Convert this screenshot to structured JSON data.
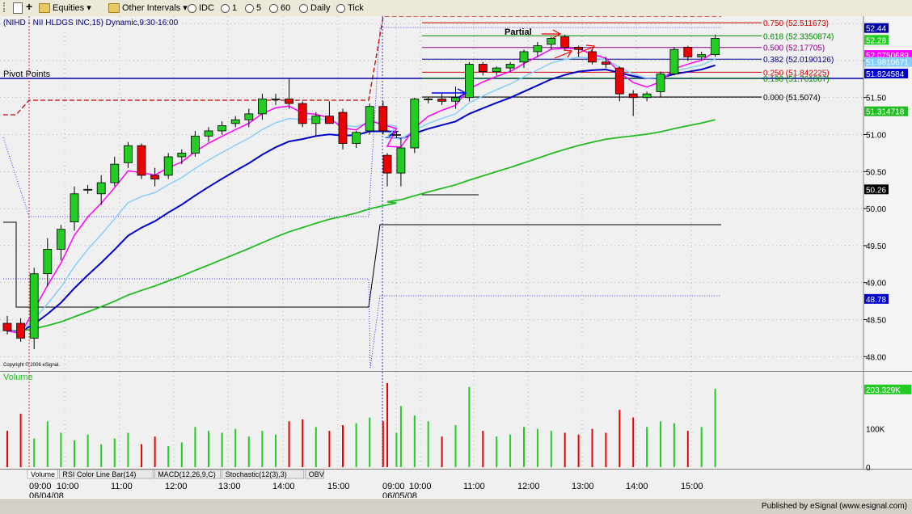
{
  "toolbar": {
    "equities_label": "Equities",
    "other_intervals_label": "Other Intervals",
    "intervals": [
      {
        "label": "IDC",
        "selected": false
      },
      {
        "label": "1",
        "selected": false
      },
      {
        "label": "5",
        "selected": false
      },
      {
        "label": "60",
        "selected": false
      },
      {
        "label": "Daily",
        "selected": false
      },
      {
        "label": "Tick",
        "selected": false
      }
    ]
  },
  "chart_title": "(NIHD - NII HLDGS INC,15) Dynamic,9:30-16:00",
  "pivot_label": "Pivot Points",
  "partial_label": "Partial",
  "copyright": "Copyright © 2006 eSignal.",
  "volume_label": "Volume",
  "published": "Published by eSignal (www.esignal.com)",
  "colors": {
    "up": "#22cc22",
    "down": "#ee0000",
    "ema_fast": "#ff00ff",
    "ema_light": "#87cefa",
    "ma_blue": "#0000cc",
    "ma_green": "#22bb22",
    "pivot": "#0000aa",
    "stop": "#cc0000"
  },
  "price_axis": {
    "ticks": [
      "52.00",
      "51.50",
      "51.00",
      "50.50",
      "50.00",
      "49.50",
      "49.00",
      "48.50",
      "48.00"
    ],
    "badges": [
      {
        "text": "52.44",
        "color": "#0000aa"
      },
      {
        "text": "52.28",
        "color": "#22cc22"
      },
      {
        "text": "52.0750689",
        "color": "#ff00ff"
      },
      {
        "text": "51.9810671",
        "color": "#87cefa"
      },
      {
        "text": "51.824584",
        "color": "#0000cc"
      },
      {
        "text": "51.314718",
        "color": "#22bb22"
      },
      {
        "text": "50.26",
        "color": "#000000"
      },
      {
        "text": "48.78",
        "color": "#0000cc"
      }
    ]
  },
  "volume_axis": {
    "ticks": [
      "203.329K",
      "100K",
      "0"
    ]
  },
  "time_axis": {
    "times": [
      "09:00",
      "10:00",
      "11:00",
      "12:00",
      "13:00",
      "14:00",
      "15:00",
      "09:00",
      "10:00",
      "11:00",
      "12:00",
      "13:00",
      "14:00",
      "15:00"
    ],
    "dates": [
      "06/04/08",
      "06/05/08"
    ]
  },
  "fib_levels": [
    {
      "text": "0.750 (52.511673)",
      "color": "#cc0000"
    },
    {
      "text": "0.618 (52.3350874)",
      "color": "#008800"
    },
    {
      "text": "0.500 (52.17705)",
      "color": "#880088"
    },
    {
      "text": "0.382 (52.0190126)",
      "color": "#000088"
    },
    {
      "text": "0.250 (51.842225)",
      "color": "#cc0000"
    },
    {
      "text": "0.190 (51.761867)",
      "color": "#008800"
    },
    {
      "text": "0.000 (51.5074)",
      "color": "#000000"
    }
  ],
  "tabs": [
    "Volume",
    "RSI Color Line Bar(14)",
    "MACD(12,26,9,C)",
    "Stochastic(12(3),3)",
    "OBV"
  ],
  "chart_data": {
    "type": "candlestick",
    "symbol": "NIHD",
    "interval": "15",
    "ylim": [
      47.85,
      52.6
    ],
    "volume_ylim": [
      0,
      220
    ],
    "bars": [
      {
        "o": 48.45,
        "h": 48.55,
        "l": 48.3,
        "c": 48.35,
        "v": 95
      },
      {
        "o": 48.45,
        "h": 48.52,
        "l": 48.2,
        "c": 48.25,
        "v": 140
      },
      {
        "o": 48.25,
        "h": 49.2,
        "l": 48.1,
        "c": 49.12,
        "v": 75
      },
      {
        "o": 49.12,
        "h": 49.6,
        "l": 48.95,
        "c": 49.45,
        "v": 120
      },
      {
        "o": 49.45,
        "h": 49.78,
        "l": 49.3,
        "c": 49.72,
        "v": 90
      },
      {
        "o": 49.82,
        "h": 50.3,
        "l": 49.7,
        "c": 50.2,
        "v": 70
      },
      {
        "o": 50.25,
        "h": 50.32,
        "l": 50.2,
        "c": 50.26,
        "v": 85
      },
      {
        "o": 50.2,
        "h": 50.45,
        "l": 50.05,
        "c": 50.35,
        "v": 60
      },
      {
        "o": 50.35,
        "h": 50.7,
        "l": 50.3,
        "c": 50.6,
        "v": 75
      },
      {
        "o": 50.62,
        "h": 50.9,
        "l": 50.55,
        "c": 50.85,
        "v": 90
      },
      {
        "o": 50.85,
        "h": 50.88,
        "l": 50.4,
        "c": 50.45,
        "v": 60
      },
      {
        "o": 50.45,
        "h": 50.55,
        "l": 50.3,
        "c": 50.4,
        "v": 80
      },
      {
        "o": 50.45,
        "h": 50.75,
        "l": 50.4,
        "c": 50.7,
        "v": 55
      },
      {
        "o": 50.7,
        "h": 50.8,
        "l": 50.6,
        "c": 50.75,
        "v": 65
      },
      {
        "o": 50.75,
        "h": 51.05,
        "l": 50.7,
        "c": 50.98,
        "v": 105
      },
      {
        "o": 50.98,
        "h": 51.1,
        "l": 50.9,
        "c": 51.05,
        "v": 95
      },
      {
        "o": 51.05,
        "h": 51.18,
        "l": 51.0,
        "c": 51.12,
        "v": 90
      },
      {
        "o": 51.15,
        "h": 51.25,
        "l": 51.1,
        "c": 51.2,
        "v": 100
      },
      {
        "o": 51.2,
        "h": 51.35,
        "l": 51.1,
        "c": 51.28,
        "v": 80
      },
      {
        "o": 51.28,
        "h": 51.55,
        "l": 51.2,
        "c": 51.48,
        "v": 95
      },
      {
        "o": 51.48,
        "h": 51.55,
        "l": 51.4,
        "c": 51.48,
        "v": 85
      },
      {
        "o": 51.48,
        "h": 51.75,
        "l": 51.35,
        "c": 51.42,
        "v": 120
      },
      {
        "o": 51.42,
        "h": 51.45,
        "l": 51.1,
        "c": 51.15,
        "v": 125
      },
      {
        "o": 51.15,
        "h": 51.3,
        "l": 50.98,
        "c": 51.25,
        "v": 105
      },
      {
        "o": 51.25,
        "h": 51.45,
        "l": 51.15,
        "c": 51.15,
        "v": 95
      },
      {
        "o": 51.3,
        "h": 51.35,
        "l": 50.8,
        "c": 50.88,
        "v": 110
      },
      {
        "o": 50.88,
        "h": 51.05,
        "l": 50.82,
        "c": 51.03,
        "v": 115
      },
      {
        "o": 51.05,
        "h": 51.42,
        "l": 51.0,
        "c": 51.38,
        "v": 130
      },
      {
        "o": 51.38,
        "h": 51.45,
        "l": 51.0,
        "c": 51.05,
        "v": 120
      },
      {
        "o": 51.0,
        "h": 51.05,
        "l": 50.95,
        "c": 51.0,
        "v": 90
      },
      {
        "o": 50.72,
        "h": 50.75,
        "l": 50.3,
        "c": 50.48,
        "v": 220
      },
      {
        "o": 50.48,
        "h": 50.95,
        "l": 50.3,
        "c": 50.82,
        "v": 160
      },
      {
        "o": 50.82,
        "h": 51.5,
        "l": 50.75,
        "c": 51.48,
        "v": 135
      },
      {
        "o": 51.48,
        "h": 51.5,
        "l": 51.42,
        "c": 51.48,
        "v": 120
      },
      {
        "o": 51.48,
        "h": 51.55,
        "l": 51.4,
        "c": 51.45,
        "v": 80
      },
      {
        "o": 51.45,
        "h": 51.65,
        "l": 51.35,
        "c": 51.5,
        "v": 110
      },
      {
        "o": 51.5,
        "h": 51.98,
        "l": 51.45,
        "c": 51.95,
        "v": 210
      },
      {
        "o": 51.95,
        "h": 51.98,
        "l": 51.8,
        "c": 51.85,
        "v": 95
      },
      {
        "o": 51.85,
        "h": 51.92,
        "l": 51.8,
        "c": 51.9,
        "v": 80
      },
      {
        "o": 51.9,
        "h": 51.98,
        "l": 51.85,
        "c": 51.95,
        "v": 85
      },
      {
        "o": 51.98,
        "h": 52.15,
        "l": 51.9,
        "c": 52.12,
        "v": 105
      },
      {
        "o": 52.12,
        "h": 52.25,
        "l": 52.05,
        "c": 52.2,
        "v": 100
      },
      {
        "o": 52.22,
        "h": 52.32,
        "l": 52.15,
        "c": 52.3,
        "v": 95
      },
      {
        "o": 52.32,
        "h": 52.35,
        "l": 52.15,
        "c": 52.18,
        "v": 90
      },
      {
        "o": 52.18,
        "h": 52.2,
        "l": 52.05,
        "c": 52.15,
        "v": 85
      },
      {
        "o": 52.12,
        "h": 52.15,
        "l": 51.95,
        "c": 51.98,
        "v": 100
      },
      {
        "o": 51.98,
        "h": 52.05,
        "l": 51.9,
        "c": 51.95,
        "v": 90
      },
      {
        "o": 51.9,
        "h": 51.92,
        "l": 51.45,
        "c": 51.55,
        "v": 150
      },
      {
        "o": 51.55,
        "h": 51.6,
        "l": 51.25,
        "c": 51.5,
        "v": 130
      },
      {
        "o": 51.5,
        "h": 51.58,
        "l": 51.45,
        "c": 51.55,
        "v": 105
      },
      {
        "o": 51.58,
        "h": 51.85,
        "l": 51.5,
        "c": 51.82,
        "v": 120
      },
      {
        "o": 51.82,
        "h": 52.18,
        "l": 51.8,
        "c": 52.15,
        "v": 115
      },
      {
        "o": 52.18,
        "h": 52.2,
        "l": 52.0,
        "c": 52.05,
        "v": 95
      },
      {
        "o": 52.05,
        "h": 52.12,
        "l": 52.0,
        "c": 52.08,
        "v": 105
      },
      {
        "o": 52.08,
        "h": 52.35,
        "l": 52.05,
        "c": 52.3,
        "v": 205
      }
    ]
  }
}
